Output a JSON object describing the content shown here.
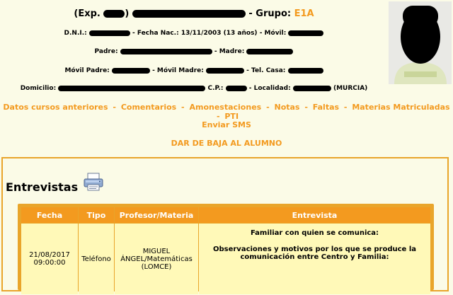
{
  "student": {
    "exp_prefix": "(Exp.",
    "exp_close": ")",
    "grupo_label": "- Grupo:",
    "grupo_value": "E1A"
  },
  "fields": {
    "dni_label": "D.N.I.:",
    "fecha_nac_label": "- Fecha Nac.:",
    "fecha_nac_value": "13/11/2003 (13 años)",
    "movil_label": "- Móvil:",
    "padre_label": "Padre:",
    "madre_label": "- Madre:",
    "movil_padre_label": "Móvil Padre:",
    "movil_madre_label": "- Móvil Madre:",
    "tel_casa_label": "- Tel. Casa:",
    "domicilio_label": "Domicilio:",
    "cp_label": "C.P.:",
    "localidad_label": "- Localidad:",
    "localidad_suffix": "(MURCIA)"
  },
  "nav_links": [
    "Datos cursos anteriores",
    "Comentarios",
    "Amonestaciones",
    "Notas",
    "Faltas",
    "Materias Matriculadas",
    "PTI"
  ],
  "separator": "-",
  "enviar_sms": "Enviar SMS",
  "dar_de_baja": "DAR DE BAJA AL ALUMNO",
  "section_title": "Entrevistas",
  "table": {
    "headers": [
      "Fecha",
      "Tipo",
      "Profesor/Materia",
      "Entrevista"
    ],
    "rows": [
      {
        "fecha": "21/08/2017",
        "hora": "09:00:00",
        "tipo": "Teléfono",
        "profesor_line1": "MIGUEL",
        "profesor_line2": "ÁNGEL/Matemáticas",
        "profesor_line3": "(LOMCE)",
        "entrevista_p1": "Familiar con quien se comunica:",
        "entrevista_p2": "Observaciones y motivos por los que se produce la comunicación entre Centro y Familia:"
      }
    ]
  },
  "colors": {
    "accent": "#f39a1f",
    "background": "#fbfbe7",
    "table_body": "#fff9b8",
    "border": "#e9a52b"
  },
  "icons": {
    "print": "printer-icon"
  }
}
